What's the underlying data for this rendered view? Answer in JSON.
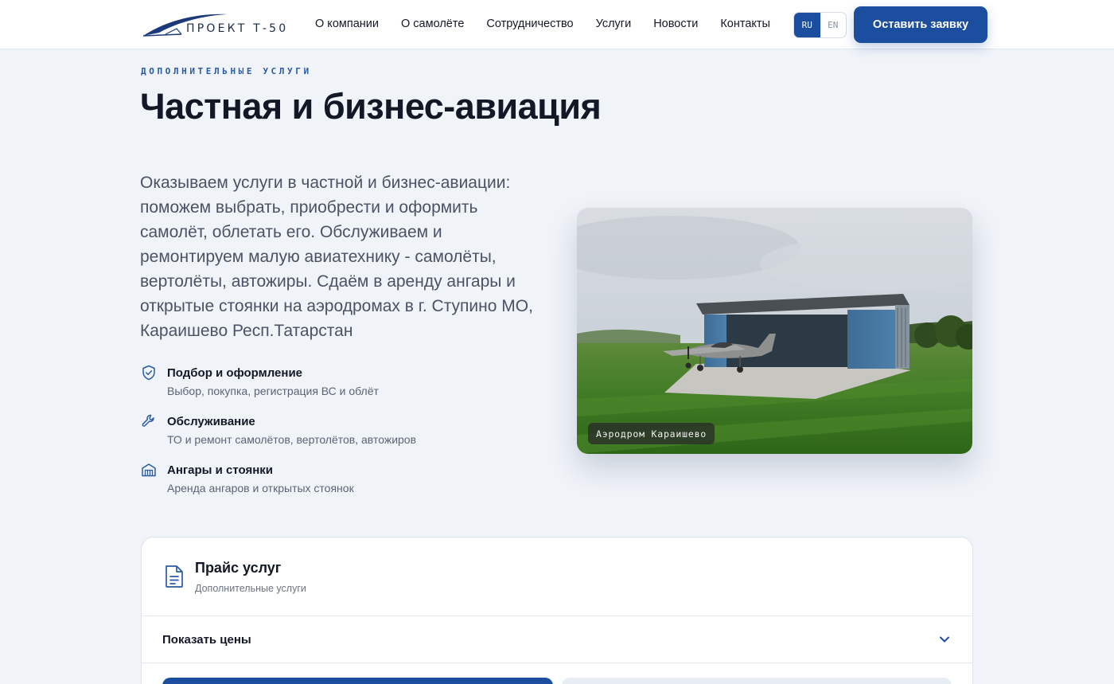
{
  "header": {
    "logo_text": "ПРОЕКТ Т-50",
    "nav": [
      "О компании",
      "О самолёте",
      "Сотрудничество",
      "Услуги",
      "Новости",
      "Контакты"
    ],
    "lang": {
      "ru": "RU",
      "en": "EN",
      "active": "RU"
    },
    "cta_label": "Оставить заявку"
  },
  "hero": {
    "eyebrow": "ДОПОЛНИТЕЛЬНЫЕ УСЛУГИ",
    "title": "Частная и бизнес-авиация",
    "lead": "Оказываем услуги в частной и бизнес-авиации: поможем выбрать, приобрести и оформить самолёт, облетать его. Обслуживаем и ремонтируем малую авиатехнику - самолёты, вертолёты, автожиры. Сдаём в аренду ангары и открытые стоянки на аэродромах в г. Ступино МО, Караишево Респ.Татарстан",
    "features": [
      {
        "icon": "shield-check-icon",
        "title": "Подбор и оформление",
        "desc": "Выбор, покупка, регистрация ВС и облёт"
      },
      {
        "icon": "wrench-icon",
        "title": "Обслуживание",
        "desc": "ТО и ремонт самолётов, вертолётов, автожиров"
      },
      {
        "icon": "hangar-icon",
        "title": "Ангары и стоянки",
        "desc": "Аренда ангаров и открытых стоянок"
      }
    ],
    "photo_caption": "Аэродром Караишево"
  },
  "price": {
    "title": "Прайс услуг",
    "subtitle": "Дополнительные услуги",
    "toggle_label": "Показать цены"
  },
  "colors": {
    "accent": "#1c4ea0",
    "background": "#f0f4f9",
    "text": "#121826"
  }
}
